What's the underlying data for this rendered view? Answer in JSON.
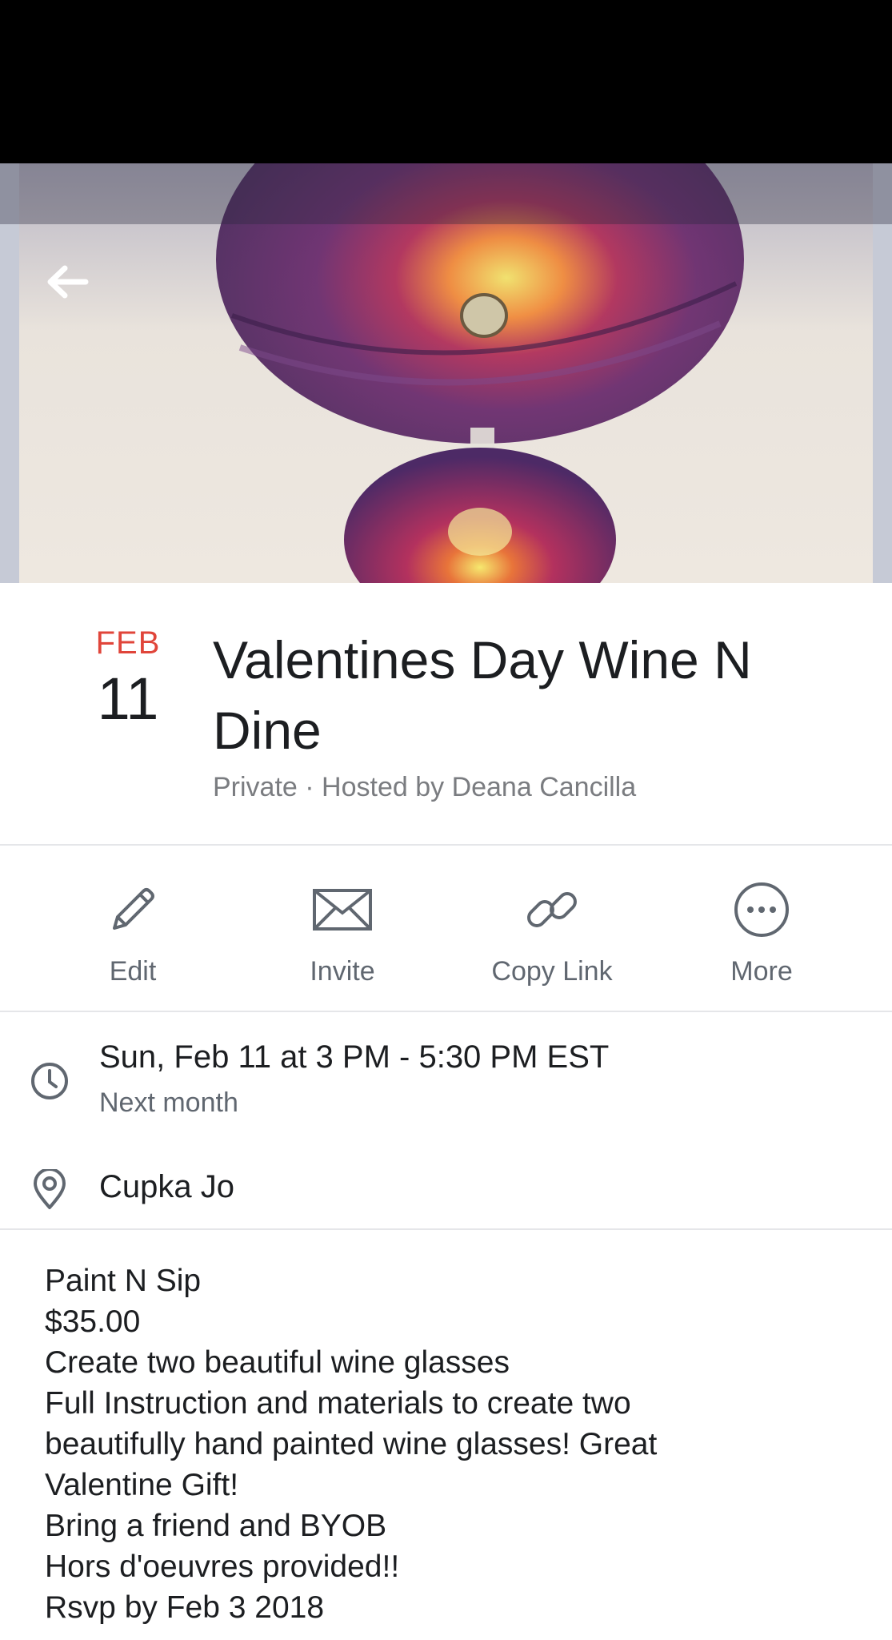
{
  "header": {
    "month": "FEB",
    "day": "11",
    "title": "Valentines Day Wine N Dine",
    "subtitle": "Private · Hosted by Deana Cancilla"
  },
  "actions": [
    {
      "label": "Edit",
      "icon": "pencil-icon"
    },
    {
      "label": "Invite",
      "icon": "envelope-icon"
    },
    {
      "label": "Copy Link",
      "icon": "link-icon"
    },
    {
      "label": "More",
      "icon": "more-icon"
    }
  ],
  "time": {
    "main": "Sun, Feb 11 at 3 PM - 5:30 PM EST",
    "sub": "Next month",
    "icon": "clock-icon"
  },
  "location": {
    "main": "Cupka Jo",
    "icon": "location-pin-icon"
  },
  "description": {
    "lines": [
      "Paint N Sip",
      "$35.00",
      "Create two beautiful wine glasses",
      "Full Instruction and materials to create two",
      "beautifully hand painted wine glasses! Great",
      "Valentine Gift!",
      "Bring a friend and BYOB",
      "Hors d'oeuvres provided!!",
      "Rsvp by Feb 3 2018"
    ]
  },
  "colors": {
    "month_accent": "#e0453a",
    "text_primary": "#1c1e21",
    "text_secondary": "#606770"
  }
}
